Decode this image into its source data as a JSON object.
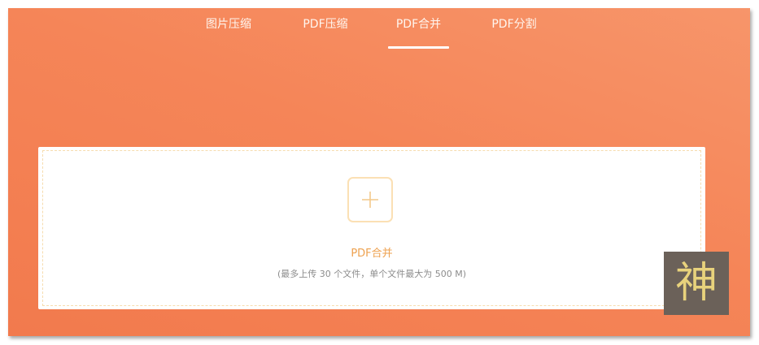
{
  "tabs": [
    {
      "label": "图片压缩",
      "active": false
    },
    {
      "label": "PDF压缩",
      "active": false
    },
    {
      "label": "PDF合并",
      "active": true
    },
    {
      "label": "PDF分割",
      "active": false
    }
  ],
  "upload": {
    "icon": "plus-icon",
    "title": "PDF合并",
    "hint": "(最多上传 30 个文件，单个文件最大为 500 M)"
  },
  "badge": {
    "char": "神"
  },
  "colors": {
    "background": "#f58558",
    "accent": "#eea14f",
    "dashed_border": "#f6dcae",
    "card": "#ffffff"
  }
}
